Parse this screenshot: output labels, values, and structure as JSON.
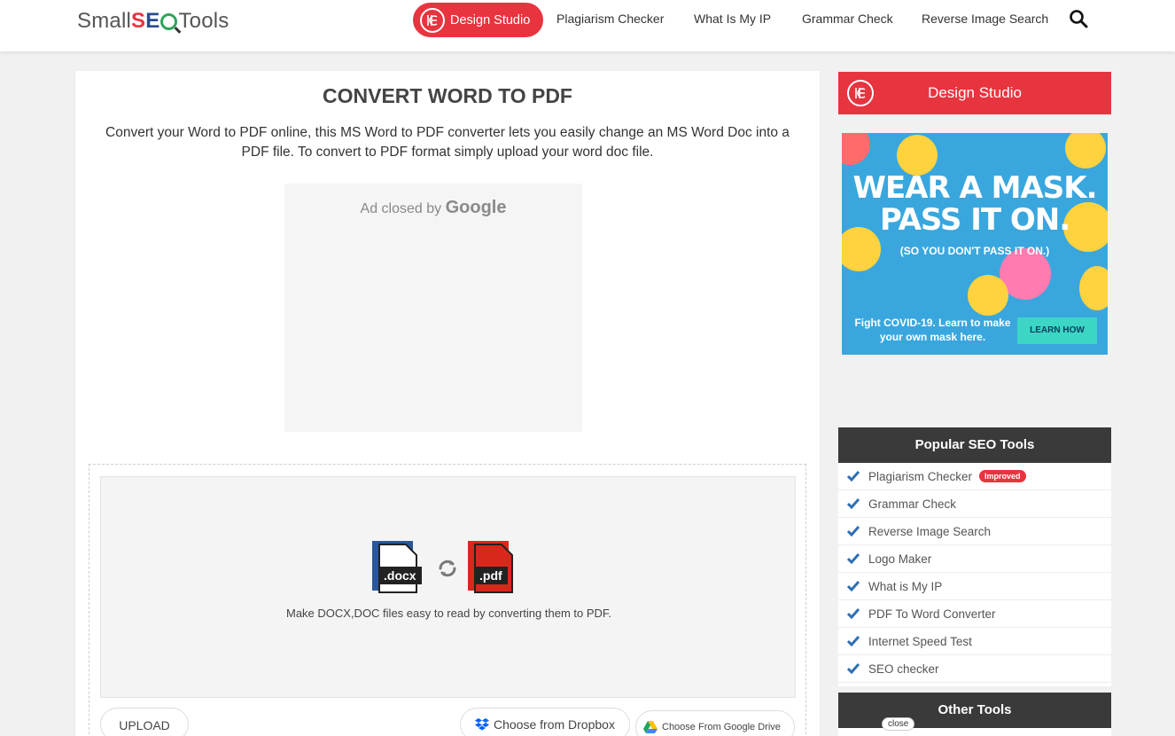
{
  "header": {
    "logo": {
      "small": "Small",
      "s": "S",
      "e": "E",
      "tools": "Tools"
    },
    "nav": {
      "design_studio": "Design Studio",
      "plagiarism": "Plagiarism Checker",
      "my_ip": "What Is My IP",
      "grammar": "Grammar Check",
      "reverse_image": "Reverse Image Search"
    },
    "search_icon": "search-icon"
  },
  "main": {
    "title": "CONVERT WORD TO PDF",
    "description": "Convert your Word to PDF online, this MS Word to PDF converter lets you easily change an MS Word Doc into a PDF file. To convert to PDF format simply upload your word doc file.",
    "ad": {
      "closed_by": "Ad closed by",
      "google": "Google"
    },
    "dropzone": {
      "docx_tag": ".docx",
      "pdf_tag": ".pdf",
      "hint": "Make DOCX,DOC files easy to read by converting them to PDF."
    },
    "buttons": {
      "upload": "UPLOAD",
      "dropbox": "Choose from Dropbox",
      "google_drive": "Choose From Google Drive"
    }
  },
  "sidebar": {
    "design_studio": "Design Studio",
    "mask_ad": {
      "headline1": "WEAR A MASK.",
      "headline2": "PASS IT ON.",
      "sub": "(SO YOU DON'T PASS IT ON.)",
      "foot": "Fight COVID-19. Learn to make your own mask here.",
      "cta": "LEARN HOW"
    },
    "popular": {
      "title": "Popular SEO Tools",
      "items": [
        {
          "label": "Plagiarism Checker",
          "badge": "Improved"
        },
        {
          "label": "Grammar Check"
        },
        {
          "label": "Reverse Image Search"
        },
        {
          "label": "Logo Maker"
        },
        {
          "label": "What is My IP"
        },
        {
          "label": "PDF To Word Converter"
        },
        {
          "label": "Internet Speed Test"
        },
        {
          "label": "SEO checker"
        }
      ]
    },
    "other": {
      "title": "Other Tools",
      "close": "close"
    }
  },
  "colors": {
    "brand_red": "#e8343f",
    "dark_panel": "#3a3a3a",
    "check_blue": "#2f6fb3",
    "ad_blue": "#39a7de"
  }
}
